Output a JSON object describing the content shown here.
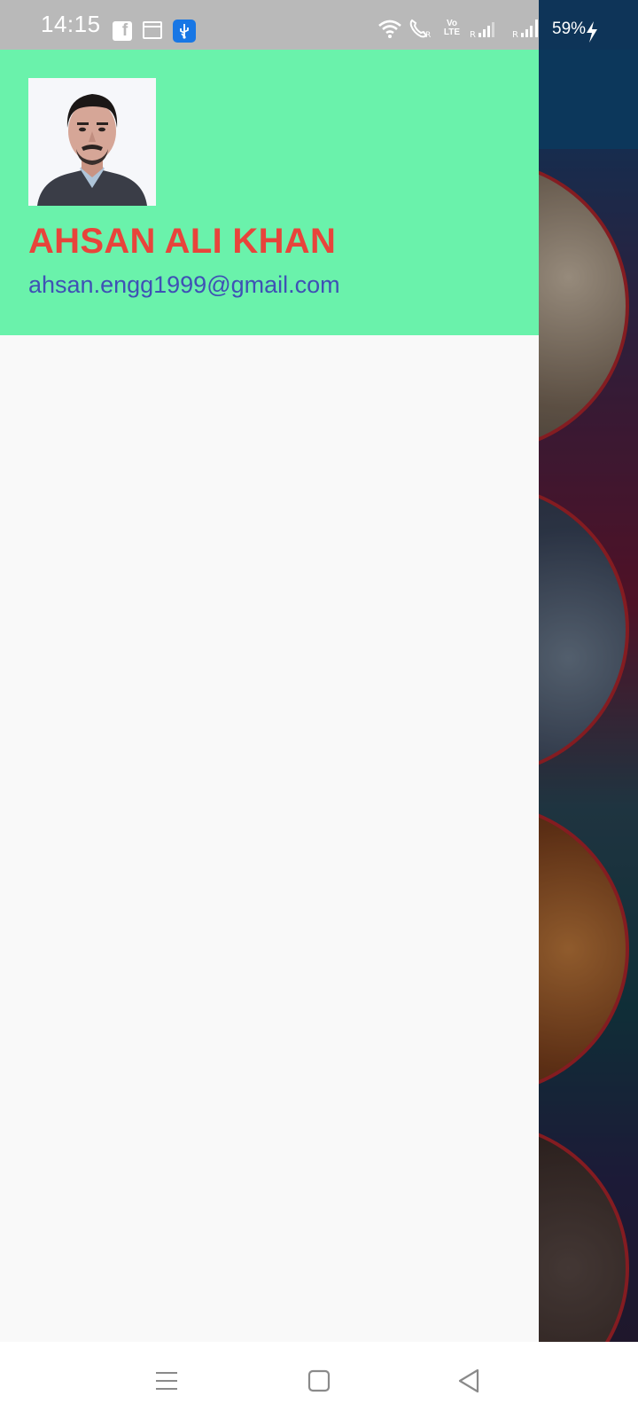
{
  "status_bar": {
    "time": "14:15",
    "battery": "59%",
    "icons": [
      "facebook-icon",
      "calendar-icon",
      "usb-icon",
      "wifi-icon",
      "wifi-call-icon",
      "volte-icon",
      "signal-icon",
      "signal-icon",
      "charging-bolt-icon"
    ]
  },
  "drawer": {
    "header_color": "#6af2ab",
    "profile": {
      "name": "AHSAN ALI KHAN",
      "email": "ahsan.engg1999@gmail.com",
      "name_color": "#e8443b",
      "email_color": "#3f51b5",
      "avatar_icon": "profile-photo"
    }
  },
  "nav_bar": {
    "buttons": [
      "menu-icon",
      "home-icon",
      "back-icon"
    ]
  }
}
